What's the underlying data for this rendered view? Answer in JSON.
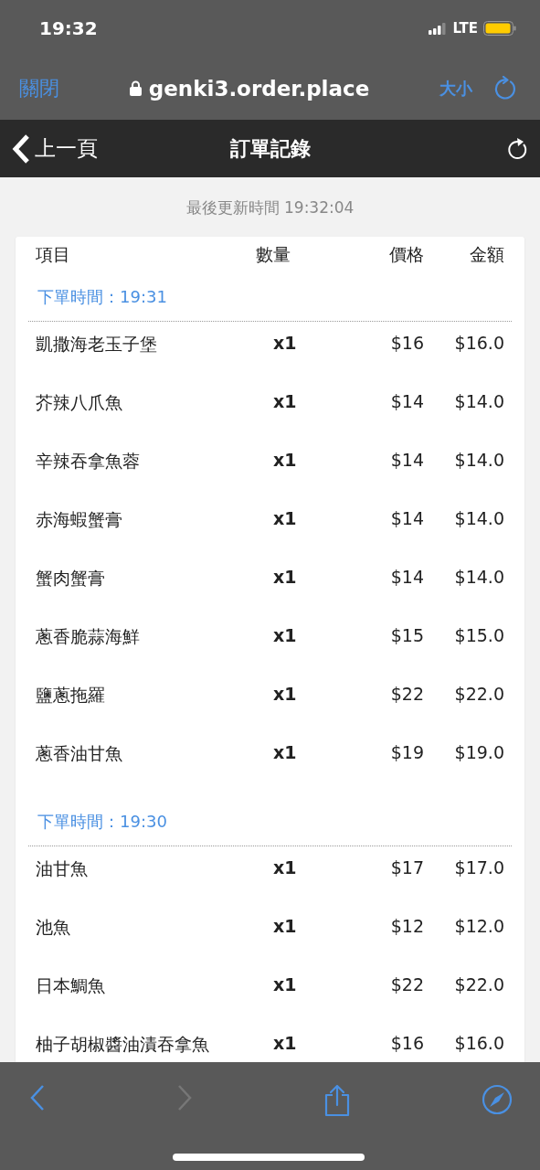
{
  "status_bar": {
    "time": "19:32",
    "network": "LTE"
  },
  "browser_bar": {
    "close": "關閉",
    "address": "genki3.order.place",
    "text_size": "大小"
  },
  "nav_bar": {
    "back": "上一頁",
    "title": "訂單記錄"
  },
  "updated": "最後更新時間 19:32:04",
  "table": {
    "columns": [
      "項目",
      "數量",
      "價格",
      "金額"
    ],
    "groups": [
      {
        "header": "下單時間：19:31",
        "rows": [
          {
            "item": "凱撒海老玉子堡",
            "qty": "x1",
            "price": "$16",
            "amount": "$16.0"
          },
          {
            "item": "芥辣八爪魚",
            "qty": "x1",
            "price": "$14",
            "amount": "$14.0"
          },
          {
            "item": "辛辣吞拿魚蓉",
            "qty": "x1",
            "price": "$14",
            "amount": "$14.0"
          },
          {
            "item": "赤海蝦蟹膏",
            "qty": "x1",
            "price": "$14",
            "amount": "$14.0"
          },
          {
            "item": "蟹肉蟹膏",
            "qty": "x1",
            "price": "$14",
            "amount": "$14.0"
          },
          {
            "item": "蔥香脆蒜海鮮",
            "qty": "x1",
            "price": "$15",
            "amount": "$15.0"
          },
          {
            "item": "鹽蔥拖羅",
            "qty": "x1",
            "price": "$22",
            "amount": "$22.0"
          },
          {
            "item": "蔥香油甘魚",
            "qty": "x1",
            "price": "$19",
            "amount": "$19.0"
          }
        ]
      },
      {
        "header": "下單時間：19:30",
        "rows": [
          {
            "item": "油甘魚",
            "qty": "x1",
            "price": "$17",
            "amount": "$17.0"
          },
          {
            "item": "池魚",
            "qty": "x1",
            "price": "$12",
            "amount": "$12.0"
          },
          {
            "item": "日本鯛魚",
            "qty": "x1",
            "price": "$22",
            "amount": "$22.0"
          },
          {
            "item": "柚子胡椒醬油漬吞拿魚",
            "qty": "x1",
            "price": "$16",
            "amount": "$16.0"
          }
        ]
      }
    ]
  },
  "toolbar": [
    {
      "kind": "back",
      "disabled": false
    },
    {
      "kind": "forward",
      "disabled": true
    },
    {
      "kind": "share",
      "disabled": false
    },
    {
      "kind": "compass",
      "disabled": false
    }
  ]
}
